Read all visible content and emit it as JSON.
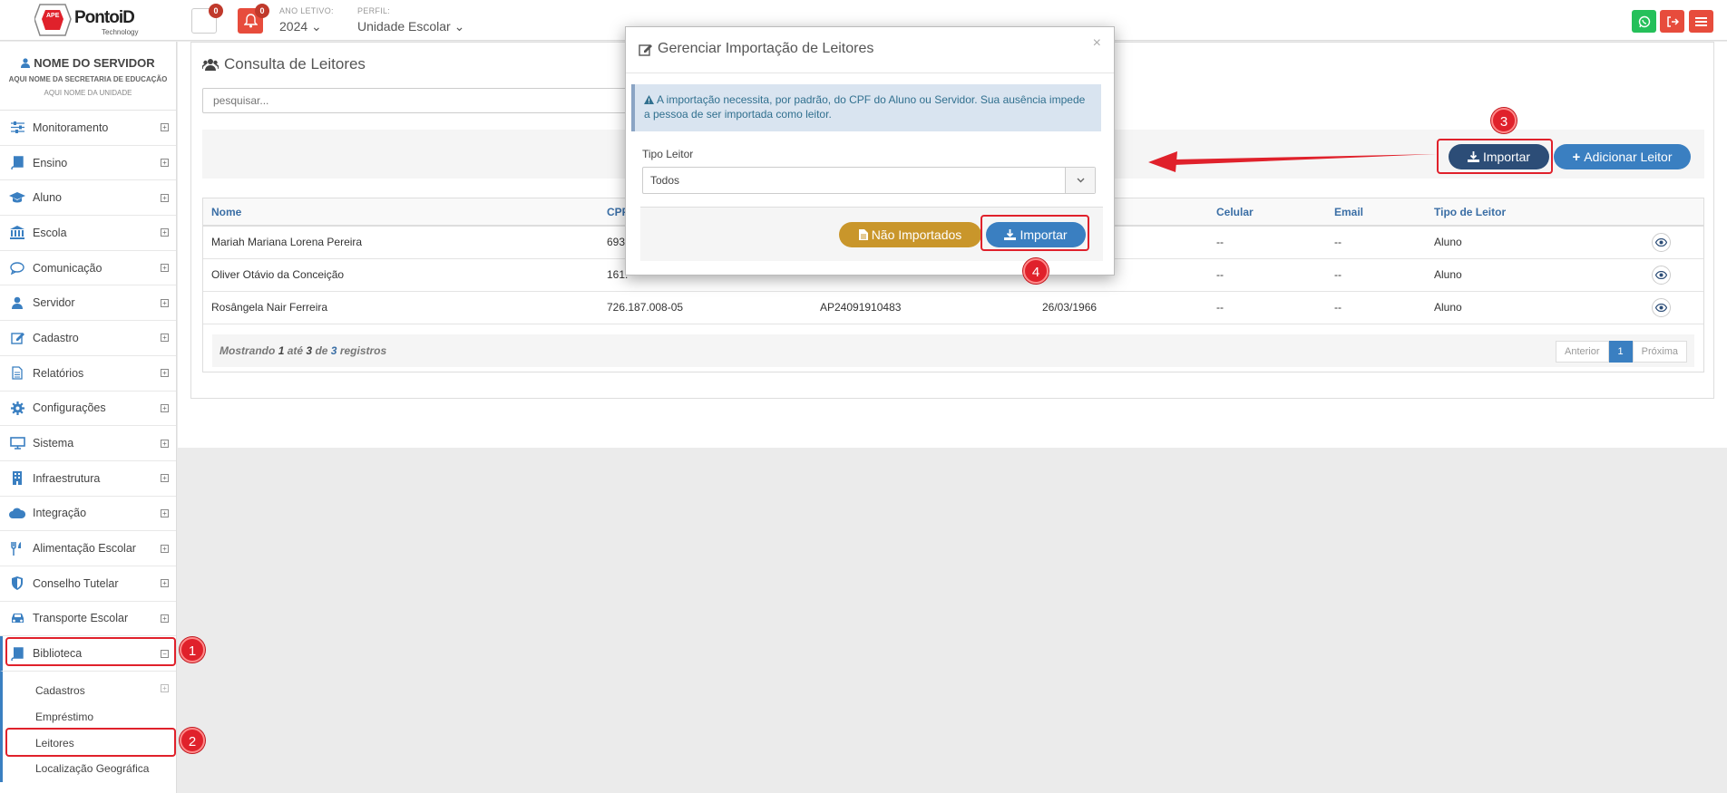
{
  "topbar": {
    "logo_text": "PontoiD",
    "logo_sub": "Technology",
    "logo_mark": "APE",
    "messages_count": "0",
    "alerts_count": "0",
    "ano_letivo_label": "ANO LETIVO:",
    "ano_letivo_value": "2024",
    "perfil_label": "PERFIL:",
    "perfil_value": "Unidade Escolar",
    "colors": {
      "whatsapp": "#25c05a",
      "logout": "#e74c3c",
      "menu": "#e74c3c"
    }
  },
  "sidebar": {
    "user_name": "NOME DO SERVIDOR",
    "secretaria": "AQUI NOME DA SECRETARIA DE EDUCAÇÃO",
    "unidade": "AQUI NOME DA UNIDADE",
    "items": [
      {
        "label": "Monitoramento",
        "icon": "sliders-icon"
      },
      {
        "label": "Ensino",
        "icon": "book-icon"
      },
      {
        "label": "Aluno",
        "icon": "graduation-cap-icon"
      },
      {
        "label": "Escola",
        "icon": "bank-icon"
      },
      {
        "label": "Comunicação",
        "icon": "chat-icon"
      },
      {
        "label": "Servidor",
        "icon": "user-icon"
      },
      {
        "label": "Cadastro",
        "icon": "edit-icon"
      },
      {
        "label": "Relatórios",
        "icon": "file-icon"
      },
      {
        "label": "Configurações",
        "icon": "gear-icon"
      },
      {
        "label": "Sistema",
        "icon": "monitor-icon"
      },
      {
        "label": "Infraestrutura",
        "icon": "building-icon"
      },
      {
        "label": "Integração",
        "icon": "cloud-icon"
      },
      {
        "label": "Alimentação Escolar",
        "icon": "utensils-icon"
      },
      {
        "label": "Conselho Tutelar",
        "icon": "shield-icon"
      },
      {
        "label": "Transporte Escolar",
        "icon": "car-icon"
      },
      {
        "label": "Biblioteca",
        "icon": "book-icon"
      }
    ],
    "biblioteca_sub": [
      "Cadastros",
      "Empréstimo",
      "Leitores",
      "Localização Geográfica"
    ]
  },
  "main": {
    "title": "Consulta de Leitores",
    "search_placeholder": "pesquisar...",
    "import_label": "Importar",
    "add_label": "Adicionar Leitor",
    "columns": [
      "Nome",
      "CPF",
      "",
      "",
      "Celular",
      "Email",
      "Tipo de Leitor"
    ],
    "rows": [
      {
        "nome": "Mariah Mariana Lorena Pereira",
        "cpf": "693.",
        "codigo": "",
        "nascimento": "",
        "celular": "--",
        "email": "--",
        "tipo": "Aluno"
      },
      {
        "nome": "Oliver Otávio da Conceição",
        "cpf": "161.",
        "codigo": "",
        "nascimento": "",
        "celular": "--",
        "email": "--",
        "tipo": "Aluno"
      },
      {
        "nome": "Rosângela Nair Ferreira",
        "cpf": "726.187.008-05",
        "codigo": "AP24091910483",
        "nascimento": "26/03/1966",
        "celular": "--",
        "email": "--",
        "tipo": "Aluno"
      }
    ],
    "footer": {
      "prefix": "Mostrando",
      "from": "1",
      "mid": "até",
      "to": "3",
      "of": "de",
      "total": "3",
      "suffix": "registros"
    },
    "pager": {
      "prev": "Anterior",
      "page": "1",
      "next": "Próxima"
    }
  },
  "modal": {
    "title": "Gerenciar Importação de Leitores",
    "close": "×",
    "alert": "A importação necessita, por padrão, do CPF do Aluno ou Servidor. Sua ausência impede a pessoa de ser importada como leitor.",
    "tipo_label": "Tipo Leitor",
    "tipo_value": "Todos",
    "not_imported_label": "Não Importados",
    "import_label": "Importar",
    "colors": {
      "not_imported": "#c9962b",
      "import": "#3a7fc1"
    }
  },
  "annotations": [
    "1",
    "2",
    "3",
    "4"
  ]
}
